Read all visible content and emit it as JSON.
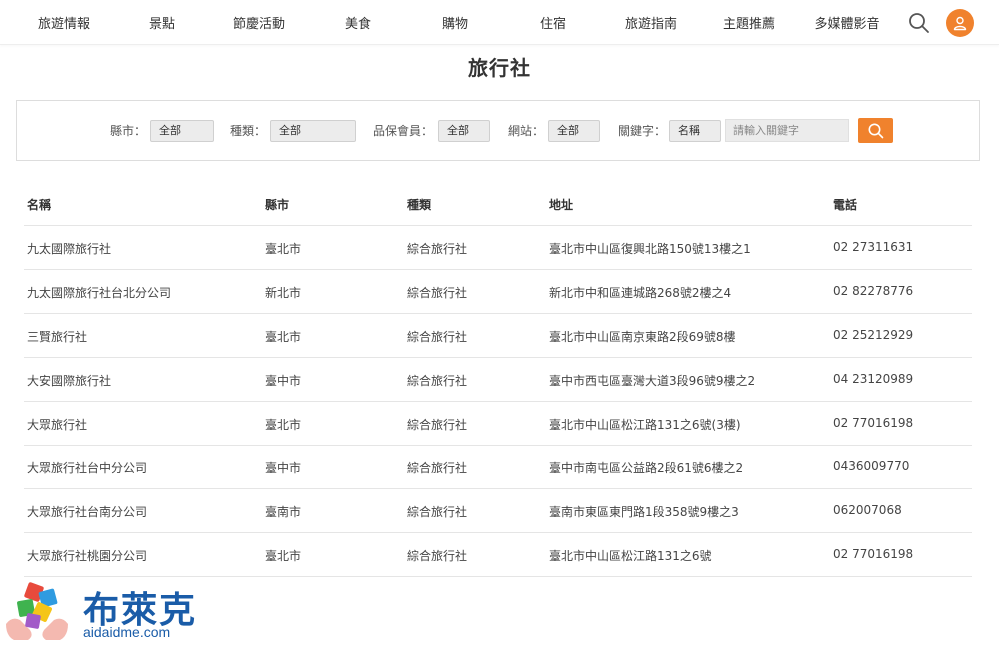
{
  "nav": {
    "items": [
      "旅遊情報",
      "景點",
      "節慶活動",
      "美食",
      "購物",
      "住宿",
      "旅遊指南",
      "主題推薦",
      "多媒體影音"
    ],
    "search_icon": "search-icon",
    "user_icon": "user-icon",
    "accent_color": "#f0822d"
  },
  "page": {
    "title": "旅行社"
  },
  "filters": {
    "county": {
      "label": "縣市：",
      "value": "全部"
    },
    "type": {
      "label": "種類：",
      "value": "全部"
    },
    "member": {
      "label": "品保會員：",
      "value": "全部"
    },
    "website": {
      "label": "網站：",
      "value": "全部"
    },
    "keyword": {
      "label": "關鍵字：",
      "field": "名稱",
      "placeholder": "請輸入關鍵字"
    },
    "search_icon": "search-icon"
  },
  "table": {
    "headers": [
      "名稱",
      "縣市",
      "種類",
      "地址",
      "電話"
    ],
    "rows": [
      [
        "九太國際旅行社",
        "臺北市",
        "綜合旅行社",
        "臺北市中山區復興北路150號13樓之1",
        "02 27311631"
      ],
      [
        "九太國際旅行社台北分公司",
        "新北市",
        "綜合旅行社",
        "新北市中和區連城路268號2樓之4",
        "02 82278776"
      ],
      [
        "三賢旅行社",
        "臺北市",
        "綜合旅行社",
        "臺北市中山區南京東路2段69號8樓",
        "02 25212929"
      ],
      [
        "大安國際旅行社",
        "臺中市",
        "綜合旅行社",
        "臺中市西屯區臺灣大道3段96號9樓之2",
        "04 23120989"
      ],
      [
        "大眾旅行社",
        "臺北市",
        "綜合旅行社",
        "臺北市中山區松江路131之6號(3樓)",
        "02 77016198"
      ],
      [
        "大眾旅行社台中分公司",
        "臺中市",
        "綜合旅行社",
        "臺中市南屯區公益路2段61號6樓之2",
        "0436009770"
      ],
      [
        "大眾旅行社台南分公司",
        "臺南市",
        "綜合旅行社",
        "臺南市東區東門路1段358號9樓之3",
        "062007068"
      ],
      [
        "大眾旅行社桃園分公司",
        "臺北市",
        "綜合旅行社",
        "臺北市中山區松江路131之6號",
        "02 77016198"
      ]
    ]
  },
  "watermark": {
    "name": "布萊克",
    "site": "aidaidme.com",
    "color": "#1a5ca8"
  }
}
